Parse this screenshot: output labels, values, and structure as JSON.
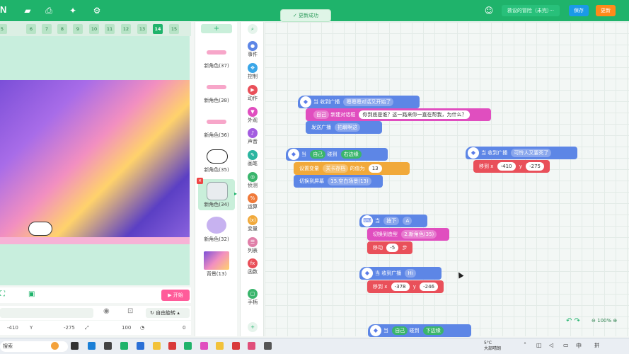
{
  "topbar": {
    "logo": "N",
    "project_name": "救设的冒险（未完）···",
    "save_label": "保存",
    "update_label": "更新",
    "toast": "更新成功"
  },
  "frames": [
    "5",
    "6",
    "7",
    "8",
    "9",
    "10",
    "11",
    "12",
    "13",
    "14",
    "15"
  ],
  "active_frame": "14",
  "stage": {
    "start_label": "▶ 开始",
    "rotation_label": "自由旋转",
    "x_value": "-410",
    "y_label": "Y",
    "y_value": "-275",
    "size_value": "100",
    "direction_value": "0"
  },
  "sprites": {
    "add_label": "+",
    "items": [
      {
        "label": "新角色(37)"
      },
      {
        "label": "新角色(38)"
      },
      {
        "label": "新角色(36)"
      },
      {
        "label": "新角色(35)"
      },
      {
        "label": "新角色(34)"
      },
      {
        "label": "新角色(32)"
      },
      {
        "label": "背景(13)"
      }
    ]
  },
  "categories": [
    {
      "label": "事件",
      "color": "#5d86e6"
    },
    {
      "label": "控制",
      "color": "#3aa6e8"
    },
    {
      "label": "动作",
      "color": "#e9505a"
    },
    {
      "label": "外观",
      "color": "#e04ebf"
    },
    {
      "label": "声音",
      "color": "#a35ce0"
    },
    {
      "label": "画笔",
      "color": "#2bb5a0"
    },
    {
      "label": "侦测",
      "color": "#3ab56c"
    },
    {
      "label": "运算",
      "color": "#f07a3a"
    },
    {
      "label": "变量",
      "color": "#f1a93a"
    },
    {
      "label": "列表",
      "color": "#e07fa8"
    },
    {
      "label": "函数",
      "color": "#e9505a"
    },
    {
      "label": "手柄",
      "color": "#3ab56c"
    }
  ],
  "blocks": {
    "b1_when": "当 收到广播",
    "b1_msg": "嗯嗯嗯对话又开始了",
    "b2_who": "自己",
    "b2_action": "新建对话框",
    "b2_text": "你到底是谁？这一路来你一直在帮我，为什么？",
    "b3_action": "发送广播",
    "b3_msg": "拍聊啊这",
    "b4_when": "当",
    "b4_who": "自己",
    "b4_touch": "碰到",
    "b4_target": "右边缘",
    "b5_action": "设置变量",
    "b5_var": "关卡存档",
    "b5_mid": "的值为",
    "b5_val": "13",
    "b6_action": "切换到屏幕",
    "b6_scene": "15.空白场景(13)",
    "b7_when": "当 收到广播",
    "b7_msg": "可怜人又要死了",
    "b8_action": "移到 x",
    "b8_x": "-410",
    "b8_y_label": "y",
    "b8_y": "-275",
    "b9_when": "当",
    "b9_press": "按下",
    "b9_key": "A",
    "b10_action": "切换到造型",
    "b10_costume": "2.新角色(35)",
    "b11_action": "移动",
    "b11_val": "-5",
    "b11_unit": "步",
    "b12_when": "当 收到广播",
    "b12_msg": "Hi",
    "b13_action": "移到 x",
    "b13_x": "-378",
    "b13_y_label": "y",
    "b13_y": "-246",
    "b14_when": "当",
    "b14_who": "自己",
    "b14_touch": "碰到",
    "b14_target": "下边缘"
  },
  "zoom": "100%",
  "taskbar": {
    "search_label": "搜索",
    "weather_temp": "5°C",
    "weather_desc": "大部晴朗",
    "ime": "中",
    "ime2": "拼"
  }
}
